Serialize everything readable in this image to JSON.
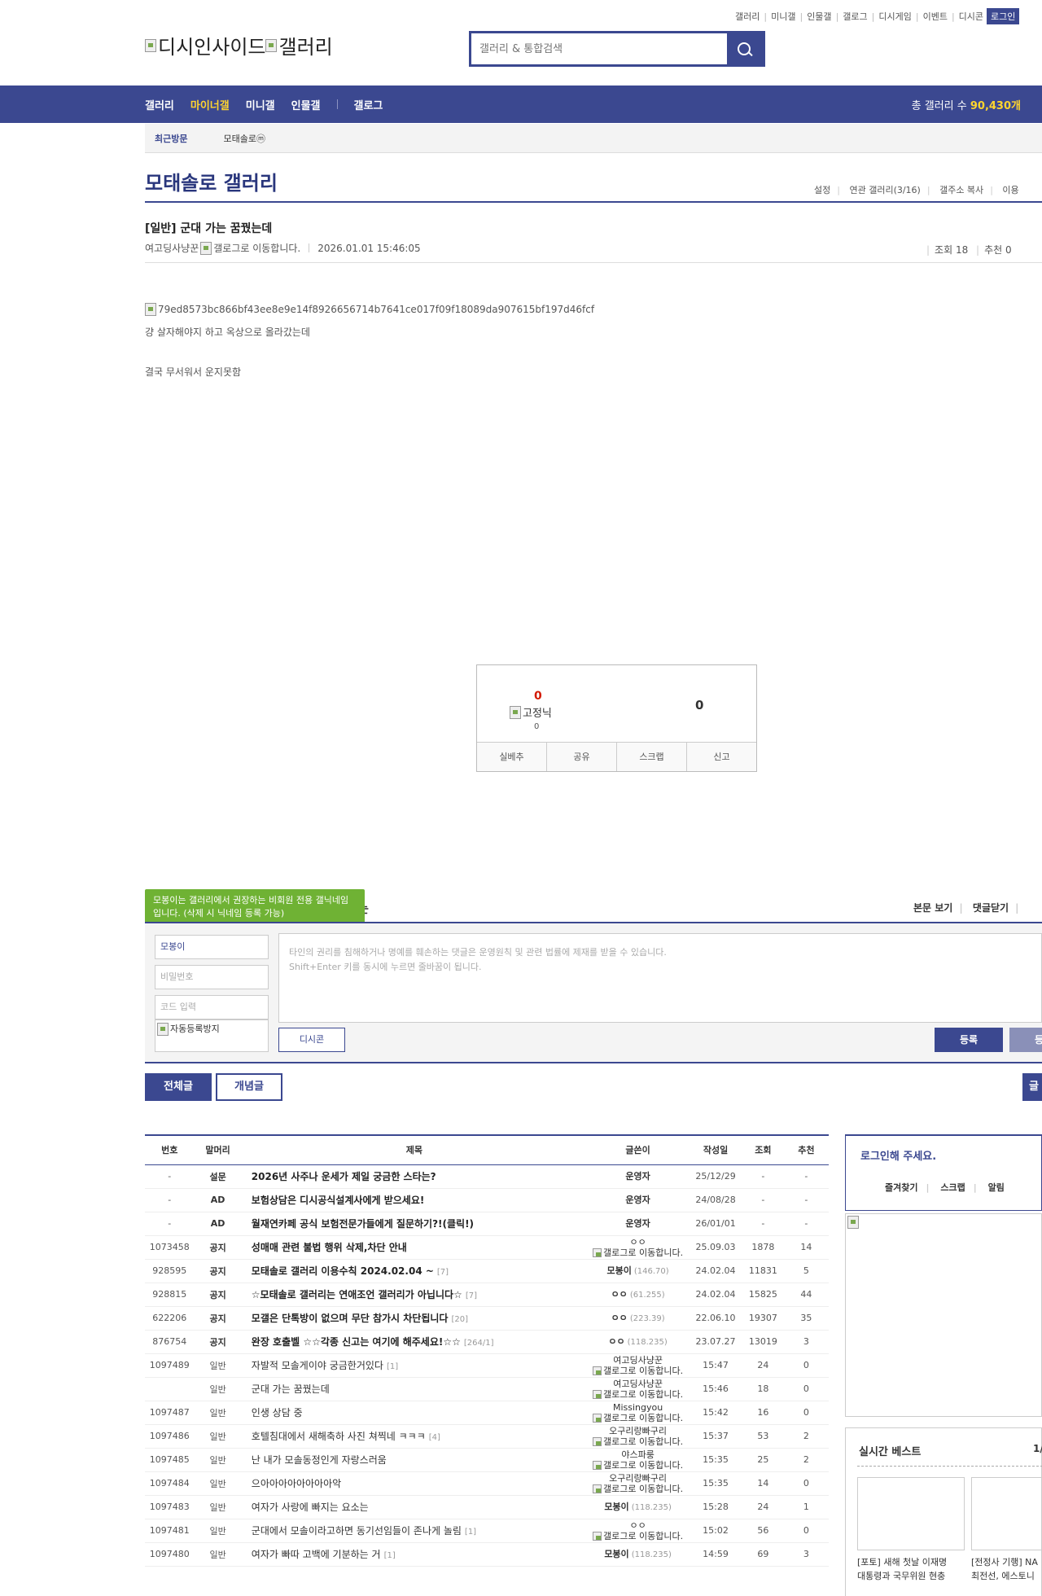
{
  "topnav": {
    "links": [
      "갤러리",
      "미니갤",
      "인물갤",
      "갤로그",
      "디시게임",
      "이벤트",
      "디시콘"
    ],
    "login": "로그인"
  },
  "header": {
    "logo_left": "디시인사이드",
    "logo_right": "갤러리",
    "search_placeholder": "갤러리 & 통합검색"
  },
  "gnb": {
    "items": [
      "갤러리",
      "마이너갤",
      "미니갤",
      "인물갤",
      "갤로그"
    ],
    "count_label": "총 갤러리 수",
    "count_value": "90,430개"
  },
  "recent": {
    "title": "최근방문",
    "item": "모태솔로ⓜ"
  },
  "gallery": {
    "title": "모태솔로 갤러리",
    "menu": [
      "설정",
      "연관 갤러리(3/16)",
      "갤주소 복사",
      "이용"
    ]
  },
  "post": {
    "title": "[일반] 군대 가는 꿈꿨는데",
    "author": "여고딩사냥꾼",
    "gallog_alt": "갤로그로 이동합니다.",
    "date": "2026.01.01 15:46:05",
    "views": "조회 18",
    "recommend": "추천 0",
    "image_alt": "79ed8573bc866bf43ee8e9e14f8926656714b7641ce017f09f18089da907615bf197d46fcf",
    "line1": "걍 살자해야지 하고 옥상으로 올라갔는데",
    "line2": "결국 무서워서 운지못함"
  },
  "recommend_box": {
    "up": "0",
    "nick": "고정닉",
    "up_fix": "0",
    "down": "0",
    "buttons": [
      "실베추",
      "공유",
      "스크랩",
      "신고"
    ]
  },
  "comment": {
    "tooltip": "모봉이는 갤러리에서 권장하는 비회원 전용 갤닉네임입니다. (삭제 시 닉네임 등록 가능)",
    "title_fragment": "는",
    "menu": [
      "본문 보기",
      "댓글닫기"
    ],
    "nick": "모봉이",
    "password": "비밀번호",
    "code": "코드 입력",
    "captcha_alt": "자동등록방지",
    "textarea_line1": "타인의 권리를 침해하거나 명예를 훼손하는 댓글은 운영원칙 및 관련 법률에 제재를 받을 수 있습니다.",
    "textarea_line2": "Shift+Enter 키를 동시에 누르면 줄바꿈이 됩니다.",
    "dccon": "디시콘",
    "submit": "등록",
    "submit2": "등록"
  },
  "tabs": [
    "전체글",
    "개념글"
  ],
  "write_label": "글",
  "list": {
    "headers": [
      "번호",
      "말머리",
      "제목",
      "글쓴이",
      "작성일",
      "조회",
      "추천"
    ],
    "rows": [
      {
        "no": "-",
        "sub": "설문",
        "title": "2026년 사주나 운세가 제일 궁금한 스타는?",
        "rc": "",
        "writer": "운영자",
        "wsub": "",
        "date": "25/12/29",
        "view": "-",
        "rec": "-"
      },
      {
        "no": "-",
        "sub": "AD",
        "title": "보험상담은 디시공식설계사에게 받으세요!",
        "rc": "",
        "writer": "운영자",
        "wsub": "",
        "date": "24/08/28",
        "view": "-",
        "rec": "-"
      },
      {
        "no": "-",
        "sub": "AD",
        "title": "월재연카페 공식 보험전문가들에게 질문하기?!(클릭!)",
        "rc": "",
        "writer": "운영자",
        "wsub": "",
        "date": "26/01/01",
        "view": "-",
        "rec": "-"
      },
      {
        "no": "1073458",
        "sub": "공지",
        "title": "성매매 관련 불법 행위 삭제,차단 안내",
        "rc": "",
        "writer": "ㅇㅇ",
        "wsub": "갤로그로 이동합니다.",
        "date": "25.09.03",
        "view": "1878",
        "rec": "14"
      },
      {
        "no": "928595",
        "sub": "공지",
        "title": "모태솔로 갤러리 이용수칙 2024.02.04 ~",
        "rc": "[7]",
        "writer": "모봉이",
        "wsub": "(146.70)",
        "date": "24.02.04",
        "view": "11831",
        "rec": "5"
      },
      {
        "no": "928815",
        "sub": "공지",
        "title": "☆모태솔로 갤러리는 연애조언 갤러리가 아닙니다☆",
        "rc": "[7]",
        "writer": "ㅇㅇ",
        "wsub": "(61.255)",
        "date": "24.02.04",
        "view": "15825",
        "rec": "44"
      },
      {
        "no": "622206",
        "sub": "공지",
        "title": "모갤은 단톡방이 없으며 무단 참가시 차단됩니다",
        "rc": "[20]",
        "writer": "ㅇㅇ",
        "wsub": "(223.39)",
        "date": "22.06.10",
        "view": "19307",
        "rec": "35"
      },
      {
        "no": "876754",
        "sub": "공지",
        "title": "완장 호출벨 ☆☆각종 신고는 여기에 해주세요!☆☆",
        "rc": "[264/1]",
        "writer": "ㅇㅇ",
        "wsub": "(118.235)",
        "date": "23.07.27",
        "view": "13019",
        "rec": "3"
      },
      {
        "no": "1097489",
        "sub": "일반",
        "title": "자발적 모솔게이야 궁금한거있다",
        "rc": "[1]",
        "writer": "여고딩사냥꾼",
        "wsub": "갤로그로 이동합니다.",
        "date": "15:47",
        "view": "24",
        "rec": "0"
      },
      {
        "no": "",
        "sub": "일반",
        "title": "군대 가는 꿈꿨는데",
        "rc": "",
        "writer": "여고딩사냥꾼",
        "wsub": "갤로그로 이동합니다.",
        "date": "15:46",
        "view": "18",
        "rec": "0"
      },
      {
        "no": "1097487",
        "sub": "일반",
        "title": "인생 상담 중",
        "rc": "",
        "writer": "Missingyou",
        "wsub": "갤로그로 이동합니다.",
        "date": "15:42",
        "view": "16",
        "rec": "0"
      },
      {
        "no": "1097486",
        "sub": "일반",
        "title": "호텔침대에서 새해축하 사진 쳐찍네 ㅋㅋㅋ",
        "rc": "[4]",
        "writer": "오구리랑빠구리",
        "wsub": "갤로그로 이동합니다.",
        "date": "15:37",
        "view": "53",
        "rec": "2"
      },
      {
        "no": "1097485",
        "sub": "일반",
        "title": "난 내가 모솔동정인게 자랑스러움",
        "rc": "",
        "writer": "야스파룽",
        "wsub": "갤로그로 이동합니다.",
        "date": "15:35",
        "view": "25",
        "rec": "2"
      },
      {
        "no": "1097484",
        "sub": "일반",
        "title": "으아아아아아아아아악",
        "rc": "",
        "writer": "오구리랑빠구리",
        "wsub": "갤로그로 이동합니다.",
        "date": "15:35",
        "view": "14",
        "rec": "0"
      },
      {
        "no": "1097483",
        "sub": "일반",
        "title": "여자가 사랑에 빠지는 요소는",
        "rc": "",
        "writer": "모봉이",
        "wsub": "(118.235)",
        "date": "15:28",
        "view": "24",
        "rec": "1"
      },
      {
        "no": "1097481",
        "sub": "일반",
        "title": "군대에서 모솔이라고하면 동기선임들이 존나게 놀림",
        "rc": "[1]",
        "writer": "ㅇㅇ",
        "wsub": "갤로그로 이동합니다.",
        "date": "15:02",
        "view": "56",
        "rec": "0"
      },
      {
        "no": "1097480",
        "sub": "일반",
        "title": "여자가 빠따 고백에 기분하는 거",
        "rc": "[1]",
        "writer": "모봉이",
        "wsub": "(118.235)",
        "date": "14:59",
        "view": "69",
        "rec": "3"
      }
    ]
  },
  "side": {
    "login_title": "로그인해 주세요.",
    "login_menu": [
      "즐겨찾기",
      "스크랩",
      "알림"
    ],
    "best_title": "실시간 베스트",
    "best_page": "1/",
    "best_items": [
      {
        "line1": "[포토] 새해 첫날 이재명",
        "line2": "대통령과 국무위원 현충"
      },
      {
        "line1": "[전정사 기행] NA",
        "line2": "최전선, 에스토니"
      }
    ]
  },
  "colors": {
    "brand": "#3b4890",
    "accent": "#ffd52e",
    "tooltip": "#6fb234"
  }
}
